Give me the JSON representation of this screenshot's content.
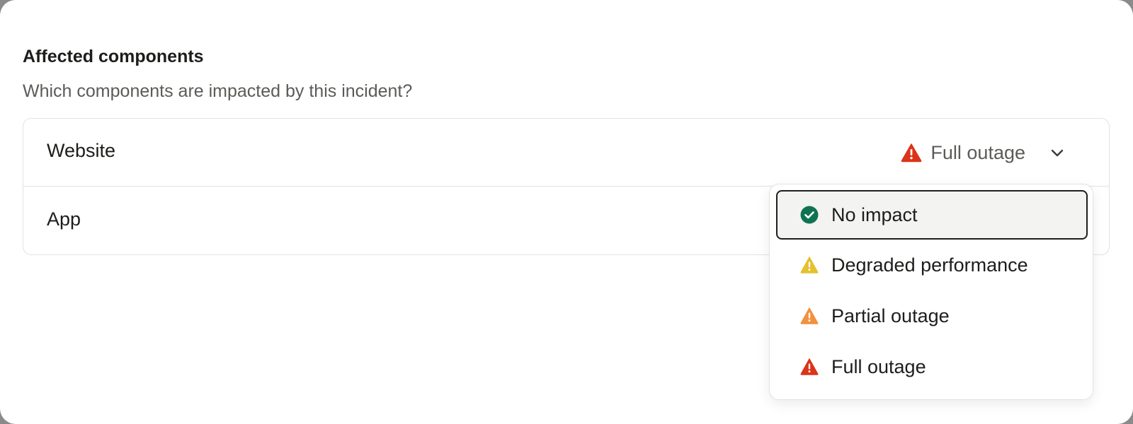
{
  "section": {
    "title": "Affected components",
    "subtitle": "Which components are impacted by this incident?"
  },
  "components": [
    {
      "name": "Website",
      "status": {
        "label": "Full outage",
        "icon": "warning-triangle-red-icon"
      }
    },
    {
      "name": "App"
    }
  ],
  "dropdown": {
    "options": [
      {
        "label": "No impact",
        "icon": "check-circle-green-icon",
        "color": "#0f7352",
        "highlighted": true
      },
      {
        "label": "Degraded performance",
        "icon": "warning-triangle-yellow-icon",
        "color": "#e4c12e"
      },
      {
        "label": "Partial outage",
        "icon": "warning-triangle-orange-icon",
        "color": "#f2913f"
      },
      {
        "label": "Full outage",
        "icon": "warning-triangle-red-icon",
        "color": "#db3419"
      }
    ]
  },
  "colors": {
    "text_primary": "#1d1d1b",
    "text_secondary": "#5b5b58",
    "border": "#e2e2de",
    "highlight_bg": "#f3f3f1"
  }
}
